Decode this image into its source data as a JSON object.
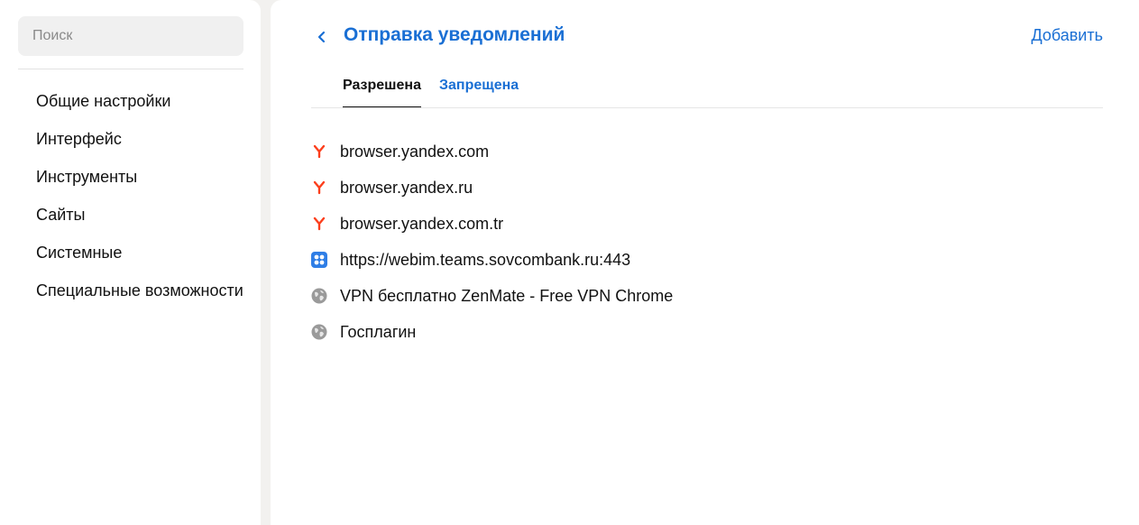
{
  "sidebar": {
    "search_placeholder": "Поиск",
    "items": [
      {
        "label": "Общие настройки"
      },
      {
        "label": "Интерфейс"
      },
      {
        "label": "Инструменты"
      },
      {
        "label": "Сайты"
      },
      {
        "label": "Системные"
      },
      {
        "label": "Специальные возможности"
      }
    ]
  },
  "header": {
    "title": "Отправка уведомлений",
    "add_label": "Добавить"
  },
  "tabs": [
    {
      "label": "Разрешена",
      "active": true
    },
    {
      "label": "Запрещена",
      "active": false
    }
  ],
  "sites": [
    {
      "name": "browser.yandex.com",
      "icon": "yandex-icon"
    },
    {
      "name": "browser.yandex.ru",
      "icon": "yandex-icon"
    },
    {
      "name": "browser.yandex.com.tr",
      "icon": "yandex-icon"
    },
    {
      "name": "https://webim.teams.sovcombank.ru:443",
      "icon": "teams-app-icon"
    },
    {
      "name": "VPN бесплатно ZenMate - Free VPN Chrome",
      "icon": "globe-icon"
    },
    {
      "name": "Госплагин",
      "icon": "globe-icon"
    }
  ],
  "colors": {
    "accent": "#1a6fd4",
    "yandex_red": "#fc3f1d",
    "teams_blue": "#2f7ee6",
    "globe_gray": "#9a9a9a",
    "background": "#f2f1ef"
  }
}
